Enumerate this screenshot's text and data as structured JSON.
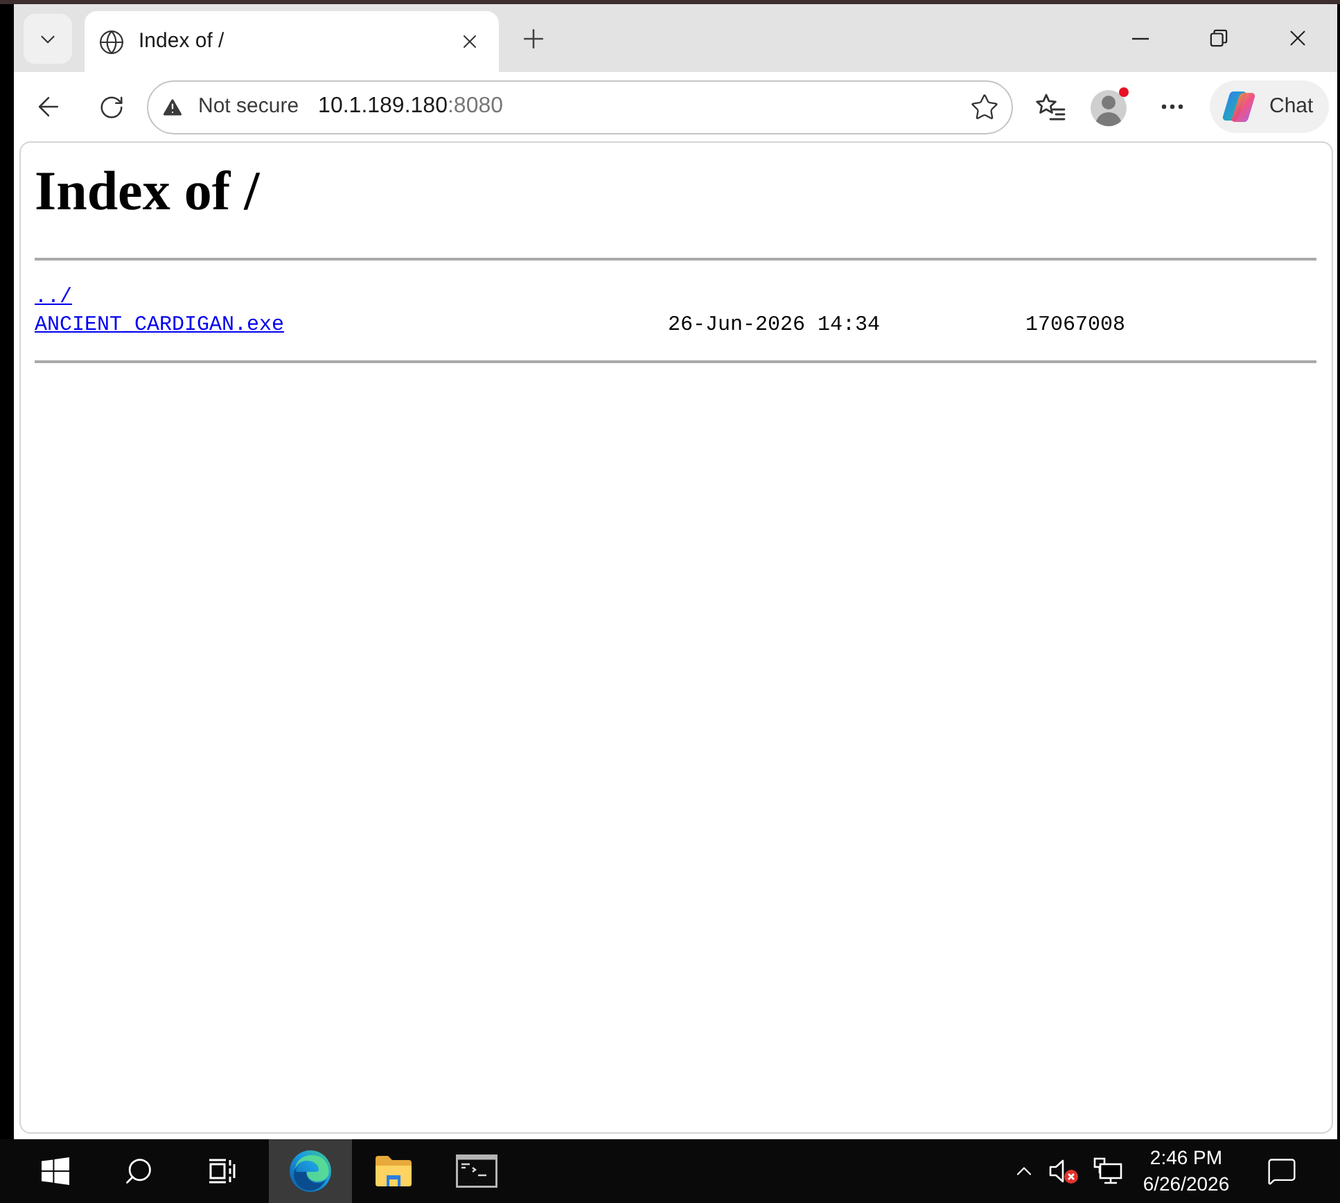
{
  "browser": {
    "tabs": [
      {
        "title": "Index of /",
        "selected": true
      }
    ],
    "address_bar": {
      "security": "Not secure",
      "host": "10.1.189.180",
      "port": ":8080"
    },
    "profile": {
      "badge": true
    },
    "chat_button": "Chat"
  },
  "page": {
    "heading": "Index of /",
    "entries": [
      {
        "name": "../"
      },
      {
        "name": "ANCIENT_CARDIGAN.exe",
        "date": "26-Jun-2026 14:34",
        "size": "17067008"
      }
    ]
  },
  "taskbar": {
    "buttons": [
      {
        "kind": "start",
        "selected": false
      },
      {
        "kind": "search",
        "selected": false
      },
      {
        "kind": "task_view",
        "selected": false
      },
      {
        "kind": "edge",
        "selected": true
      },
      {
        "kind": "folder",
        "selected": false
      },
      {
        "kind": "terminal",
        "selected": false
      }
    ],
    "tray": {
      "volume_muted": true
    },
    "clock": {
      "time": "2:46 PM",
      "date": "6/26/2026"
    }
  }
}
